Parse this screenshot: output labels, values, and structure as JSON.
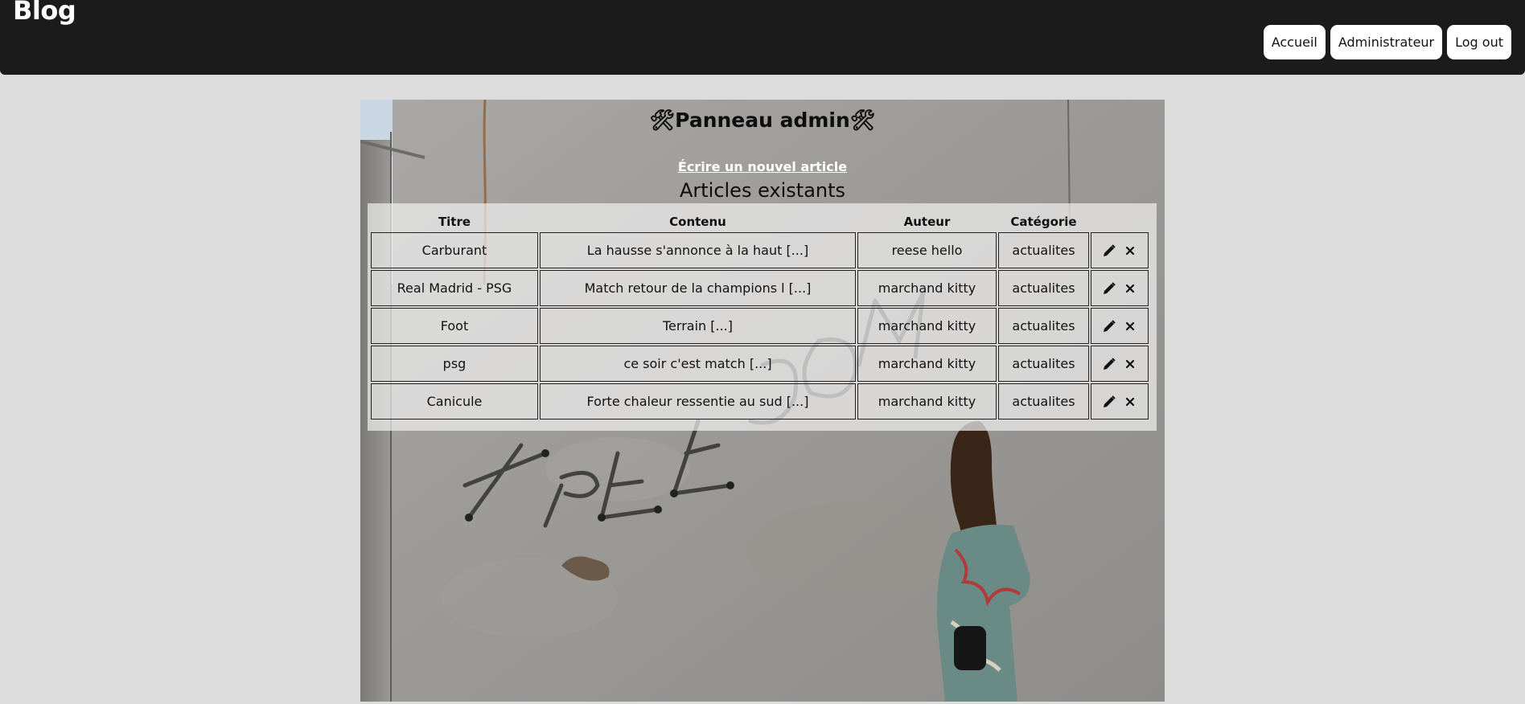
{
  "header": {
    "brand": "Blog",
    "nav": [
      {
        "label": "Accueil"
      },
      {
        "label": "Administrateur"
      },
      {
        "label": "Log out"
      }
    ]
  },
  "panel": {
    "title": "🛠Panneau admin🛠",
    "new_article_link": "Écrire un nouvel article",
    "section_heading": "Articles existants",
    "columns": [
      "Titre",
      "Contenu",
      "Auteur",
      "Catégorie",
      ""
    ],
    "rows": [
      {
        "title": "Carburant",
        "content": "La hausse s'annonce à la haut [...]",
        "author": "reese hello",
        "category": "actualites"
      },
      {
        "title": "Real Madrid - PSG",
        "content": "Match retour de la champions l [...]",
        "author": "marchand kitty",
        "category": "actualites"
      },
      {
        "title": "Foot",
        "content": "Terrain [...]",
        "author": "marchand kitty",
        "category": "actualites"
      },
      {
        "title": "psg",
        "content": "ce soir c'est match [...]",
        "author": "marchand kitty",
        "category": "actualites"
      },
      {
        "title": "Canicule",
        "content": "Forte chaleur ressentie au sud [...]",
        "author": "marchand kitty",
        "category": "actualites"
      }
    ],
    "row_actions": {
      "edit_icon": "pencil-icon",
      "delete_icon": "close-icon"
    },
    "background": {
      "graffiti_text": "FREEDOM"
    }
  }
}
